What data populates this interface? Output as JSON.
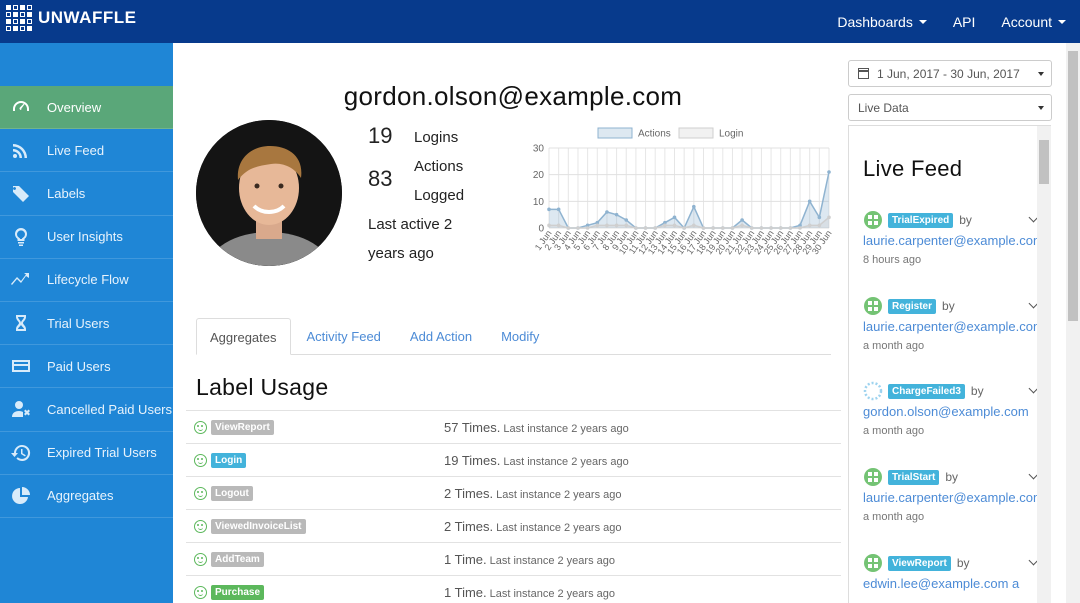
{
  "brand": {
    "name": "UNWAFFLE"
  },
  "topnav": {
    "dashboards": "Dashboards",
    "api": "API",
    "account": "Account"
  },
  "sidebar": {
    "items": [
      {
        "label": "Overview",
        "icon": "speedometer-icon",
        "active": true
      },
      {
        "label": "Live Feed",
        "icon": "rss-icon"
      },
      {
        "label": "Labels",
        "icon": "tag-icon"
      },
      {
        "label": "User Insights",
        "icon": "lightbulb-icon"
      },
      {
        "label": "Lifecycle Flow",
        "icon": "trend-icon"
      },
      {
        "label": "Trial Users",
        "icon": "hourglass-icon"
      },
      {
        "label": "Paid Users",
        "icon": "credit-card-icon"
      },
      {
        "label": "Cancelled Paid Users",
        "icon": "user-remove-icon"
      },
      {
        "label": "Expired Trial Users",
        "icon": "history-icon"
      },
      {
        "label": "Aggregates",
        "icon": "pie-chart-icon"
      }
    ]
  },
  "user": {
    "email": "gordon.olson@example.com",
    "logins_count": "19",
    "logins_label": "Logins",
    "actions_count": "83",
    "actions_label_1": "Actions",
    "actions_label_2": "Logged",
    "last_active": "Last active 2 years ago"
  },
  "chart_data": {
    "type": "area",
    "legend": [
      "Actions",
      "Login"
    ],
    "legend_position": "top",
    "ylim": [
      0,
      30
    ],
    "yticks": [
      0,
      10,
      20,
      30
    ],
    "categories": [
      "1 Jun",
      "2 Jun",
      "3 Jun",
      "4 Jun",
      "5 Jun",
      "6 Jun",
      "7 Jun",
      "8 Jun",
      "9 Jun",
      "10 Jun",
      "11 Jun",
      "12 Jun",
      "13 Jun",
      "14 Jun",
      "15 Jun",
      "16 Jun",
      "17 Jun",
      "18 Jun",
      "19 Jun",
      "20 Jun",
      "21 Jun",
      "22 Jun",
      "23 Jun",
      "24 Jun",
      "25 Jun",
      "26 Jun",
      "27 Jun",
      "28 Jun",
      "29 Jun",
      "30 Jun"
    ],
    "series": [
      {
        "name": "Actions",
        "values": [
          7,
          7,
          0,
          0,
          1,
          2,
          6,
          5,
          3,
          0,
          0,
          0,
          2,
          4,
          0,
          8,
          0,
          0,
          0,
          0,
          3,
          0,
          0,
          0,
          0,
          0,
          1,
          10,
          4,
          21
        ],
        "color": "#8fb3d0"
      },
      {
        "name": "Login",
        "values": [
          1,
          1,
          0,
          0,
          0,
          1,
          1,
          1,
          1,
          0,
          0,
          0,
          1,
          1,
          0,
          1,
          0,
          0,
          0,
          0,
          1,
          0,
          0,
          0,
          0,
          0,
          0,
          1,
          1,
          4
        ],
        "color": "#cfcfcf"
      }
    ],
    "grid": true
  },
  "tabs": [
    {
      "label": "Aggregates",
      "active": true
    },
    {
      "label": "Activity Feed"
    },
    {
      "label": "Add Action"
    },
    {
      "label": "Modify"
    }
  ],
  "label_usage": {
    "title": "Label Usage",
    "rows": [
      {
        "label": "ViewReport",
        "color": "grey",
        "count": "57 Times.",
        "instance": "Last instance 2 years ago"
      },
      {
        "label": "Login",
        "color": "blue",
        "count": "19 Times.",
        "instance": "Last instance 2 years ago"
      },
      {
        "label": "Logout",
        "color": "grey",
        "count": "2 Times.",
        "instance": "Last instance 2 years ago"
      },
      {
        "label": "ViewedInvoiceList",
        "color": "grey",
        "count": "2 Times.",
        "instance": "Last instance 2 years ago"
      },
      {
        "label": "AddTeam",
        "color": "grey",
        "count": "1 Time.",
        "instance": "Last instance 2 years ago"
      },
      {
        "label": "Purchase",
        "color": "green",
        "count": "1 Time.",
        "instance": "Last instance 2 years ago"
      }
    ]
  },
  "filters": {
    "date_range": "1 Jun, 2017 - 30 Jun, 2017",
    "data_source": "Live Data"
  },
  "live_feed": {
    "title": "Live Feed",
    "items": [
      {
        "label": "TrialExpired",
        "by": "by",
        "email": "laurie.carpenter@example.com",
        "time": "8 hours ago"
      },
      {
        "label": "Register",
        "by": "by",
        "email": "laurie.carpenter@example.com",
        "time": "a month ago"
      },
      {
        "label": "ChargeFailed3",
        "by": "by",
        "email": "gordon.olson@example.com",
        "time": "a month ago"
      },
      {
        "label": "TrialStart",
        "by": "by",
        "email": "laurie.carpenter@example.com",
        "time": "a month ago"
      },
      {
        "label": "ViewReport",
        "by": "by",
        "email": "edwin.lee@example.com a",
        "time": ""
      }
    ]
  }
}
